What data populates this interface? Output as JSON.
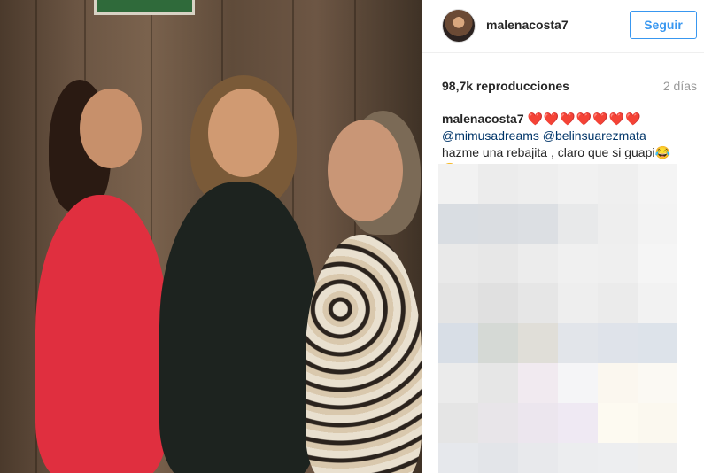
{
  "media": {
    "description_icon": "video-frame"
  },
  "header": {
    "username": "malenacosta7",
    "follow_label": "Seguir"
  },
  "stats": {
    "views": "98,7k reproducciones",
    "time_ago": "2 días"
  },
  "caption": {
    "author": "malenacosta7",
    "hearts": "❤️❤️❤️❤️❤️❤️❤️",
    "mention_1": "@mimusadreams",
    "mention_2": "@belinsuarezmata",
    "text": "hazme una rebajita , claro que si guapi😂😝"
  },
  "colors": {
    "accent": "#3897f0",
    "mention": "#003569",
    "muted": "#999999"
  },
  "blur_tiles": [
    "#f2f2f2",
    "#ececec",
    "#eeeeee",
    "#f1f1f1",
    "#efefef",
    "#f4f4f4",
    "#ffffff",
    "#d9dde2",
    "#dadde1",
    "#dcdfe3",
    "#e8e9ea",
    "#eeeeee",
    "#f3f3f3",
    "#ffffff",
    "#e9e9e9",
    "#e7e7e7",
    "#ececec",
    "#f0f0f0",
    "#efefef",
    "#f5f5f5",
    "#ffffff",
    "#e4e4e4",
    "#e0e0e0",
    "#e6e6e6",
    "#eeeeee",
    "#ebebeb",
    "#f2f2f2",
    "#ffffff",
    "#d8dee6",
    "#d5d9d5",
    "#e0ded8",
    "#e2e5ea",
    "#dfe3ea",
    "#dde3ea",
    "#ffffff",
    "#ebebeb",
    "#e6e6e6",
    "#f1eaf0",
    "#f5f5f7",
    "#fbf7ef",
    "#fbf9f3",
    "#ffffff",
    "#e5e5e5",
    "#e8e5e9",
    "#ece6ee",
    "#efe9f3",
    "#fdfaf1",
    "#fbf8ef",
    "#ffffff",
    "#e6e8ec",
    "#e3e5e9",
    "#e8e9ec",
    "#ecedef",
    "#edeef0",
    "#eeeeee",
    "#ffffff"
  ]
}
